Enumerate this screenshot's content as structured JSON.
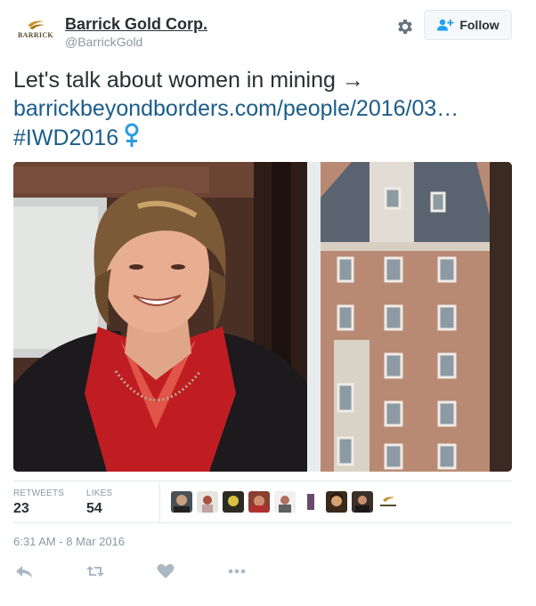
{
  "author": {
    "logo_text": "BARRICK",
    "name": "Barrick Gold Corp.",
    "handle": "@BarrickGold"
  },
  "header": {
    "follow_label": "Follow"
  },
  "tweet": {
    "line1": "Let's talk about women in mining →",
    "link": "barrickbeyondborders.com/people/2016/03…",
    "hashtag": "#IWD2016"
  },
  "stats": {
    "retweets_label": "RETWEETS",
    "retweets_count": "23",
    "likes_label": "LIKES",
    "likes_count": "54"
  },
  "liker_avatars": [
    "user-avatar",
    "user-avatar",
    "user-avatar",
    "user-avatar",
    "user-avatar",
    "user-avatar",
    "user-avatar",
    "user-avatar",
    "barrick-logo-avatar"
  ],
  "timestamp": "6:31 AM - 8 Mar 2016",
  "actions": [
    "reply-icon",
    "retweet-icon",
    "like-icon",
    "more-icon"
  ],
  "colors": {
    "link": "#1b5d8a",
    "muted": "#8899a6",
    "venus": "#2b9de0",
    "follow_icon": "#1da1f2"
  }
}
